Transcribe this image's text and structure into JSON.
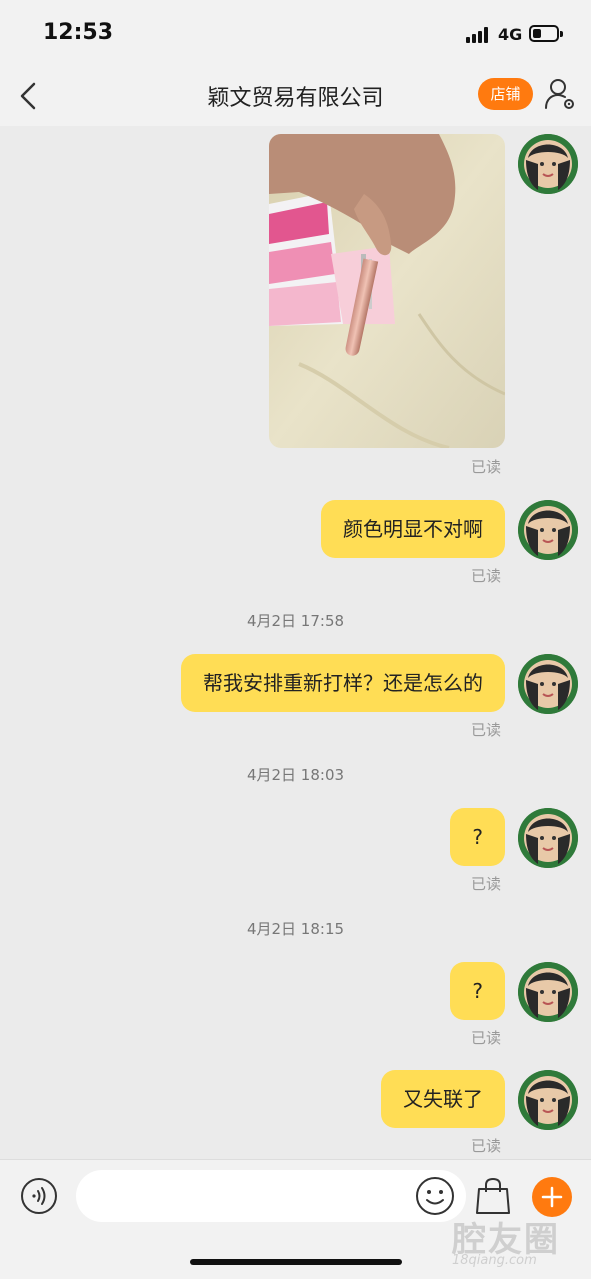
{
  "status_bar": {
    "time": "12:53",
    "network": "4G"
  },
  "header": {
    "title": "颖文贸易有限公司",
    "shop_label": "店铺"
  },
  "messages": [
    {
      "type": "image",
      "read": "已读"
    },
    {
      "type": "text",
      "text": "颜色明显不对啊",
      "read": "已读"
    },
    {
      "type": "timestamp",
      "text": "4月2日 17:58"
    },
    {
      "type": "text",
      "text": "帮我安排重新打样？还是怎么的",
      "read": "已读"
    },
    {
      "type": "timestamp",
      "text": "4月2日 18:03"
    },
    {
      "type": "text",
      "text": "?",
      "read": "已读"
    },
    {
      "type": "timestamp",
      "text": "4月2日 18:15"
    },
    {
      "type": "text",
      "text": "?",
      "read": "已读"
    },
    {
      "type": "text",
      "text": "又失联了",
      "read": "已读"
    }
  ],
  "input": {
    "value": "",
    "placeholder": ""
  },
  "watermark": {
    "main": "腔友圈",
    "sub": "18qiang.com"
  },
  "colors": {
    "accent": "#ff7a0f",
    "bubble": "#ffdd55",
    "background": "#ebebeb"
  },
  "icons": [
    "back-icon",
    "profile-settings-icon",
    "voice-icon",
    "emoji-icon",
    "shopping-bag-icon",
    "plus-icon"
  ]
}
